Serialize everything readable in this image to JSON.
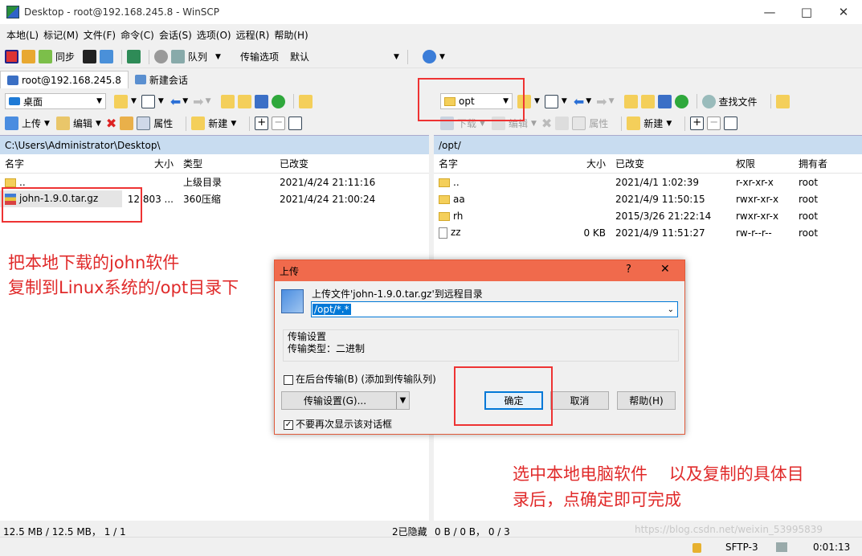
{
  "window": {
    "title": "Desktop - root@192.168.245.8 - WinSCP"
  },
  "menu": [
    "本地(L)",
    "标记(M)",
    "文件(F)",
    "命令(C)",
    "会话(S)",
    "选项(O)",
    "远程(R)",
    "帮助(H)"
  ],
  "toolbar": {
    "sync": "同步",
    "queue": "队列",
    "transfer_label": "传输选项",
    "transfer_value": "默认"
  },
  "tabs": {
    "session": "root@192.168.245.8",
    "new_session": "新建会话"
  },
  "local": {
    "location": "桌面",
    "actions": {
      "upload": "上传",
      "edit": "编辑",
      "properties": "属性",
      "new": "新建"
    },
    "path": "C:\\Users\\Administrator\\Desktop\\",
    "columns": [
      "名字",
      "大小",
      "类型",
      "已改变"
    ],
    "rows": [
      {
        "name": "..",
        "size": "",
        "type": "上级目录",
        "changed": "2021/4/24  21:11:16"
      },
      {
        "name": "john-1.9.0.tar.gz",
        "size": "12,803 ...",
        "type": "360压缩",
        "changed": "2021/4/24  21:00:24"
      }
    ],
    "status": "12.5 MB / 12.5 MB， 1 / 1",
    "hidden": "2已隐藏"
  },
  "remote": {
    "location": "opt",
    "actions": {
      "download": "下载",
      "edit": "编辑",
      "properties": "属性",
      "new": "新建",
      "find": "查找文件"
    },
    "path": "/opt/",
    "columns": [
      "名字",
      "大小",
      "已改变",
      "权限",
      "拥有者"
    ],
    "rows": [
      {
        "name": "..",
        "size": "",
        "changed": "2021/4/1 1:02:39",
        "perm": "r-xr-xr-x",
        "owner": "root"
      },
      {
        "name": "aa",
        "size": "",
        "changed": "2021/4/9 11:50:15",
        "perm": "rwxr-xr-x",
        "owner": "root"
      },
      {
        "name": "rh",
        "size": "",
        "changed": "2015/3/26 21:22:14",
        "perm": "rwxr-xr-x",
        "owner": "root"
      },
      {
        "name": "zz",
        "size": "0 KB",
        "changed": "2021/4/9 11:51:27",
        "perm": "rw-r--r--",
        "owner": "root"
      }
    ],
    "status": "0 B / 0 B， 0 / 3"
  },
  "status": {
    "protocol": "SFTP-3",
    "time": "0:01:13",
    "watermark": "https://blog.csdn.net/weixin_53995839"
  },
  "annotations": {
    "left_line1": "把本地下载的john软件",
    "left_line2": "复制到Linux系统的/opt目录下",
    "bottom_line1": "选中本地电脑软件    以及复制的具体目",
    "bottom_line2": "录后，点确定即可完成"
  },
  "dialog": {
    "title": "上传",
    "help_glyph": "?",
    "close_glyph": "✕",
    "prompt": "上传文件'john-1.9.0.tar.gz'到远程目录",
    "target": "/opt/*.*",
    "group_title": "传输设置",
    "transfer_type": "传输类型：二进制",
    "background_label": "在后台传输(B) (添加到传输队列)",
    "settings_button": "传输设置(G)...",
    "ok": "确定",
    "cancel": "取消",
    "help": "帮助(H)",
    "no_show_label": "不要再次显示该对话框"
  }
}
